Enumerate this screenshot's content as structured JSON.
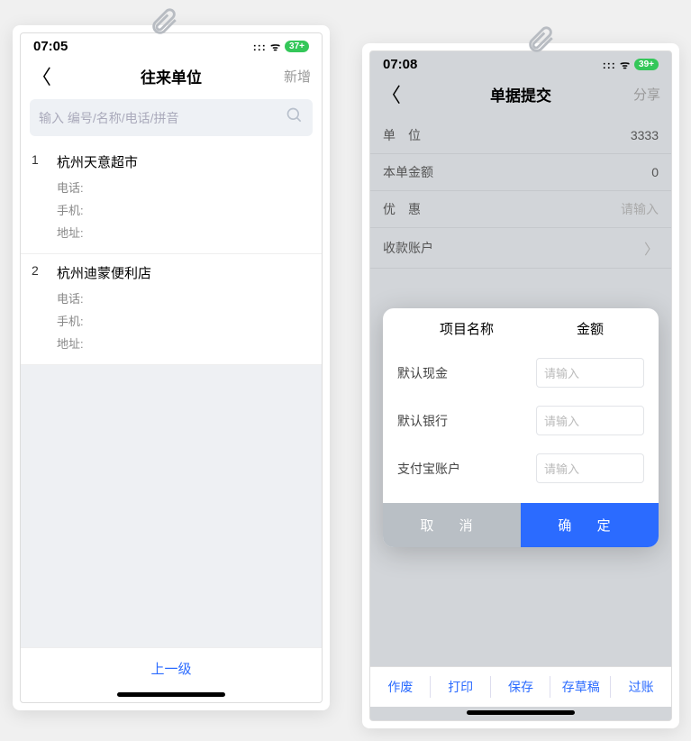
{
  "phone1": {
    "status": {
      "time": "07:05",
      "battery": "37+"
    },
    "nav": {
      "title": "往来单位",
      "action": "新增"
    },
    "search": {
      "placeholder": "输入 编号/名称/电话/拼音"
    },
    "items": [
      {
        "idx": "1",
        "name": "杭州天意超市",
        "phone_label": "电话:",
        "mobile_label": "手机:",
        "addr_label": "地址:"
      },
      {
        "idx": "2",
        "name": "杭州迪蒙便利店",
        "phone_label": "电话:",
        "mobile_label": "手机:",
        "addr_label": "地址:"
      }
    ],
    "bottom": "上一级"
  },
  "phone2": {
    "status": {
      "time": "07:08",
      "battery": "39+"
    },
    "nav": {
      "title": "单据提交",
      "action": "分享"
    },
    "rows": [
      {
        "label": "单　位",
        "value": "3333"
      },
      {
        "label": "本单金额",
        "value": "0"
      },
      {
        "label": "优　惠",
        "value": "请输入",
        "placeholder": true
      },
      {
        "label": "收款账户",
        "chevron": true
      }
    ],
    "modal": {
      "head_left": "项目名称",
      "head_right": "金额",
      "rows": [
        {
          "label": "默认现金",
          "placeholder": "请输入"
        },
        {
          "label": "默认银行",
          "placeholder": "请输入"
        },
        {
          "label": "支付宝账户",
          "placeholder": "请输入"
        }
      ],
      "cancel": "取 消",
      "ok": "确 定"
    },
    "toolbar": [
      "作废",
      "打印",
      "保存",
      "存草稿",
      "过账"
    ]
  }
}
